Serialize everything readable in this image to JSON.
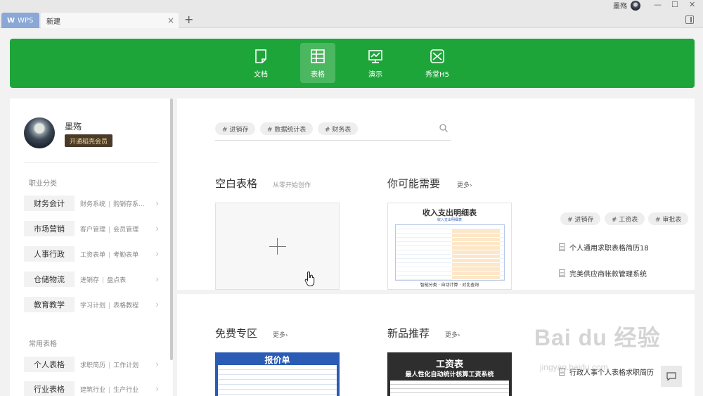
{
  "titlebar": {
    "wps_tab": "WPS",
    "new_tab": "新建",
    "close_glyph": "×",
    "add_glyph": "+",
    "user_name": "墨殇",
    "min_glyph": "—",
    "max_glyph": "☐",
    "close_win_glyph": "✕"
  },
  "apps": [
    {
      "label": "文档",
      "icon": "document-icon"
    },
    {
      "label": "表格",
      "icon": "spreadsheet-icon"
    },
    {
      "label": "演示",
      "icon": "presentation-icon"
    },
    {
      "label": "秀堂H5",
      "icon": "h5-icon"
    }
  ],
  "active_app": "表格",
  "profile": {
    "name": "墨殇",
    "vip_button": "开通稻壳会员"
  },
  "sidebar": {
    "section_career": "职业分类",
    "categories": [
      {
        "name": "财务会计",
        "subs": [
          "财务系统",
          "购销存系..."
        ]
      },
      {
        "name": "市场营销",
        "subs": [
          "客户管理",
          "会员管理"
        ]
      },
      {
        "name": "人事行政",
        "subs": [
          "工资表单",
          "考勤表单"
        ]
      },
      {
        "name": "仓储物流",
        "subs": [
          "进销存",
          "盘点表"
        ]
      },
      {
        "name": "教育教学",
        "subs": [
          "学习计划",
          "表格教程"
        ]
      }
    ],
    "section_common": "常用表格",
    "common": [
      {
        "name": "个人表格",
        "subs": [
          "求职简历",
          "工作计划"
        ]
      },
      {
        "name": "行业表格",
        "subs": [
          "建筑行业",
          "生产行业"
        ]
      }
    ],
    "separator": "|",
    "arrow": "›"
  },
  "search": {
    "tags": [
      "# 进销存",
      "# 数据统计表",
      "# 财务表"
    ]
  },
  "blank": {
    "title": "空白表格",
    "subtitle": "从零开始创作"
  },
  "needs": {
    "title": "你可能需要",
    "more": "更多›",
    "template_title": "收入支出明细表",
    "template_sub": "收入支出明细表",
    "template_caption": "智能分类 · 自动计算 · 对比查询",
    "tags": [
      "# 进销存",
      "# 工资表",
      "# 审批表"
    ],
    "items": [
      "个人通用求职表格简历18",
      "完美供应商帐款管理系统"
    ]
  },
  "free": {
    "title": "免费专区",
    "more": "更多›",
    "card_title": "报价单"
  },
  "newest": {
    "title": "新品推荐",
    "more": "更多›",
    "card_title": "工资表",
    "card_sub": "最人性化自动统计核算工资系统",
    "item": "行政人事个人表格求职简历"
  },
  "watermark": {
    "text": "Bai du 经验",
    "sub": "jingyan.baidu.com"
  },
  "colors": {
    "brand_green": "#1ea53a",
    "wps_tab": "#8aa7d6",
    "vip_bg": "#4a3a28"
  }
}
